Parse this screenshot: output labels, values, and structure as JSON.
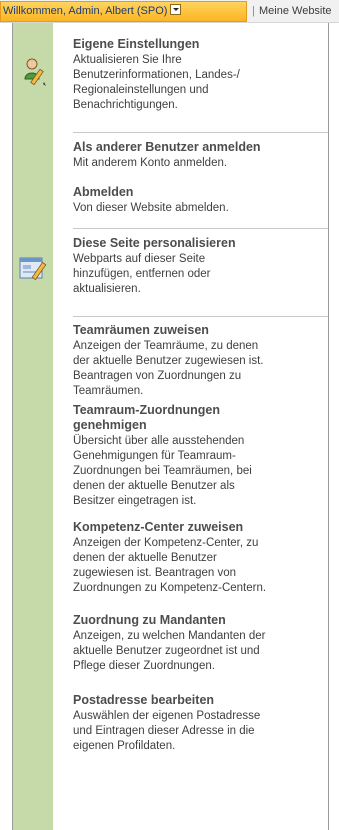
{
  "topbar": {
    "welcome": "Willkommen, Admin, Albert (SPO)",
    "separator": "|",
    "my_site": "Meine Website"
  },
  "menu": {
    "items": [
      {
        "title": "Eigene Einstellungen",
        "desc": [
          "Aktualisieren Sie Ihre",
          "Benutzerinformationen, Landes-/",
          "Regionaleinstellungen und",
          "Benachrichtigungen."
        ],
        "icon": "user-edit-icon"
      },
      {
        "title": "Als anderer Benutzer anmelden",
        "desc": [
          "Mit anderem Konto anmelden."
        ]
      },
      {
        "title": "Abmelden",
        "desc": [
          "Von dieser Website abmelden."
        ]
      },
      {
        "title": "Diese Seite personalisieren",
        "desc": [
          "Webparts auf dieser Seite",
          "hinzufügen, entfernen oder",
          "aktualisieren."
        ],
        "icon": "personalize-page-icon"
      },
      {
        "title": "Teamräumen zuweisen",
        "desc": [
          "Anzeigen der Teamräume, zu denen",
          "der aktuelle Benutzer zugewiesen ist.",
          "Beantragen von Zuordnungen zu",
          "Teamräumen."
        ]
      },
      {
        "title_lines": [
          "Teamraum-Zuordnungen",
          "genehmigen"
        ],
        "desc": [
          "Übersicht über alle ausstehenden",
          "Genehmigungen für Teamraum-",
          "Zuordnungen bei Teamräumen, bei",
          "denen der aktuelle Benutzer als",
          "Besitzer eingetragen ist."
        ]
      },
      {
        "title": "Kompetenz-Center zuweisen",
        "desc": [
          "Anzeigen der Kompetenz-Center, zu",
          "denen der aktuelle Benutzer",
          "zugewiesen ist. Beantragen von",
          "Zuordnungen zu Kompetenz-Centern."
        ]
      },
      {
        "title": "Zuordnung zu Mandanten",
        "desc": [
          "Anzeigen, zu welchen Mandanten der",
          "aktuelle Benutzer zugeordnet ist und",
          "Pflege dieser Zuordnungen."
        ]
      },
      {
        "title": "Postadresse bearbeiten",
        "desc": [
          "Auswählen der eigenen Postadresse",
          "und Eintragen dieser Adresse in die",
          "eigenen Profildaten."
        ]
      }
    ]
  }
}
